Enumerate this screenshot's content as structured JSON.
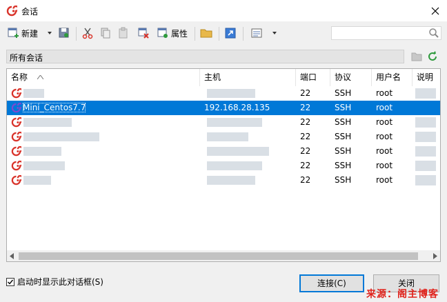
{
  "window": {
    "title": "会话"
  },
  "toolbar": {
    "new_label": "新建",
    "properties_label": "属性"
  },
  "folder": {
    "label": "所有会话"
  },
  "columns": [
    "名称",
    "主机",
    "端口",
    "协议",
    "用户名",
    "说明"
  ],
  "sessions": [
    {
      "name": "",
      "host": "",
      "port": "22",
      "protocol": "SSH",
      "user": "root",
      "selected": false
    },
    {
      "name": "Mini_Centos7.7",
      "host": "192.168.28.135",
      "port": "22",
      "protocol": "SSH",
      "user": "root",
      "selected": true
    },
    {
      "name": "",
      "host": "",
      "port": "22",
      "protocol": "SSH",
      "user": "root",
      "selected": false
    },
    {
      "name": "",
      "host": "",
      "port": "22",
      "protocol": "SSH",
      "user": "root",
      "selected": false
    },
    {
      "name": "",
      "host": "",
      "port": "22",
      "protocol": "SSH",
      "user": "root",
      "selected": false
    },
    {
      "name": "",
      "host": "",
      "port": "22",
      "protocol": "SSH",
      "user": "root",
      "selected": false
    },
    {
      "name": "",
      "host": "",
      "port": "22",
      "protocol": "SSH",
      "user": "root",
      "selected": false
    }
  ],
  "footer": {
    "show_on_startup_label": "启动时显示此对话框(S)",
    "show_on_startup_checked": true,
    "connect_label": "连接(C)",
    "close_label": "关闭"
  },
  "watermark": "来源：阁主博客",
  "colors": {
    "selection": "#0078d7",
    "brand": "#d9342b",
    "refresh": "#2e9a3c"
  },
  "icons": [
    "session-icon",
    "new-session-icon",
    "dropdown-arrow-icon",
    "save-icon",
    "cut-icon",
    "copy-icon",
    "paste-icon",
    "delete-icon",
    "properties-icon",
    "new-folder-icon",
    "shortcut-icon",
    "view-icon",
    "search-icon",
    "folder-icon",
    "refresh-icon",
    "close-icon",
    "sort-asc-icon"
  ]
}
